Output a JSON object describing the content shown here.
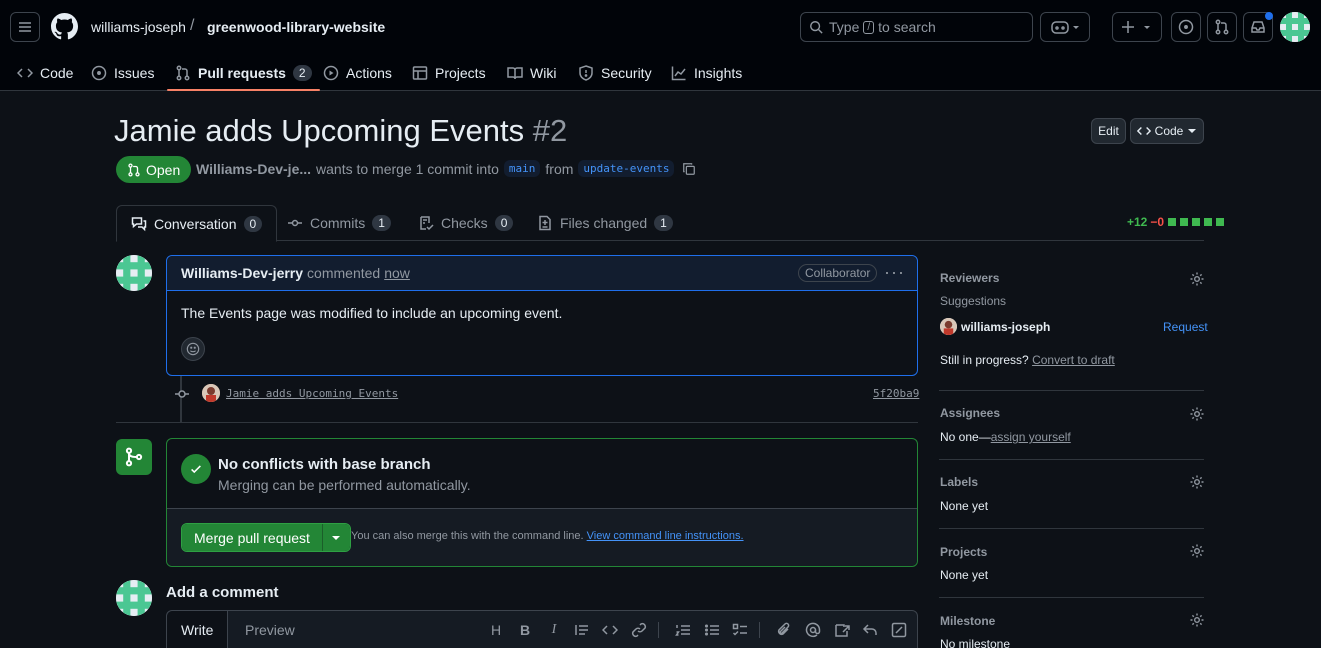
{
  "header": {
    "owner": "williams-joseph",
    "separator": "/",
    "repo": "greenwood-library-website",
    "search_prefix": "Type",
    "search_key": "/",
    "search_suffix": "to search"
  },
  "nav_tabs": [
    {
      "label": "Code",
      "icon": "code-icon"
    },
    {
      "label": "Issues",
      "icon": "issue-icon"
    },
    {
      "label": "Pull requests",
      "icon": "pull-request-icon",
      "count": "2",
      "active": true
    },
    {
      "label": "Actions",
      "icon": "play-icon"
    },
    {
      "label": "Projects",
      "icon": "table-icon"
    },
    {
      "label": "Wiki",
      "icon": "book-icon"
    },
    {
      "label": "Security",
      "icon": "shield-icon"
    },
    {
      "label": "Insights",
      "icon": "graph-icon"
    }
  ],
  "pr": {
    "title": "Jamie adds Upcoming Events",
    "number": "#2",
    "edit_label": "Edit",
    "code_label": "Code",
    "state": "Open",
    "author": "Williams-Dev-je...",
    "merge_text": "wants to merge 1 commit into",
    "base_branch": "main",
    "from_text": "from",
    "head_branch": "update-events"
  },
  "pr_tabs": [
    {
      "label": "Conversation",
      "count": "0",
      "active": true
    },
    {
      "label": "Commits",
      "count": "1"
    },
    {
      "label": "Checks",
      "count": "0"
    },
    {
      "label": "Files changed",
      "count": "1"
    }
  ],
  "diffstat": {
    "additions": "+12",
    "deletions": "−0"
  },
  "comment": {
    "author": "Williams-Dev-jerry",
    "action": "commented",
    "time": "now",
    "badge": "Collaborator",
    "more": "···",
    "body": "The Events page was modified to include an upcoming event."
  },
  "commit": {
    "message": "Jamie adds Upcoming Events",
    "sha": "5f20ba9"
  },
  "merge": {
    "title": "No conflicts with base branch",
    "subtitle": "Merging can be performed automatically.",
    "button": "Merge pull request",
    "hint": "You can also merge this with the command line.",
    "hint_link": "View command line instructions."
  },
  "add_comment": {
    "title": "Add a comment",
    "write_tab": "Write",
    "preview_tab": "Preview",
    "toolbar_heading": "H",
    "toolbar_bold": "B",
    "toolbar_italic": "I"
  },
  "sidebar": {
    "reviewers": {
      "title": "Reviewers",
      "suggestions": "Suggestions",
      "suggested_user": "williams-joseph",
      "request": "Request",
      "draft_prefix": "Still in progress?",
      "draft_link": "Convert to draft"
    },
    "assignees": {
      "title": "Assignees",
      "prefix": "No one—",
      "link": "assign yourself"
    },
    "labels": {
      "title": "Labels",
      "value": "None yet"
    },
    "projects": {
      "title": "Projects",
      "value": "None yet"
    },
    "milestone": {
      "title": "Milestone",
      "value": "No milestone"
    }
  },
  "colors": {
    "accent": "#238636",
    "underline": "#f78166",
    "link": "#4493f8"
  }
}
